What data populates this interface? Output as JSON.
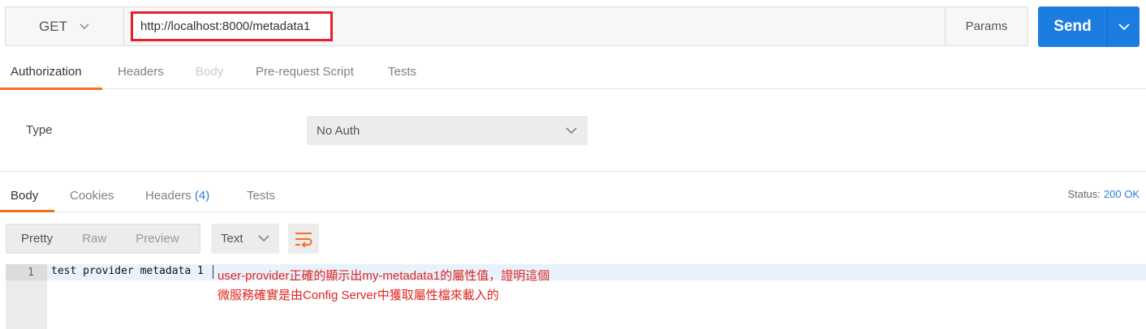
{
  "request": {
    "method": "GET",
    "url": "http://localhost:8000/metadata1",
    "params_label": "Params",
    "send_label": "Send"
  },
  "request_tabs": [
    {
      "label": "Authorization",
      "state": "active"
    },
    {
      "label": "Headers",
      "state": "normal"
    },
    {
      "label": "Body",
      "state": "disabled"
    },
    {
      "label": "Pre-request Script",
      "state": "normal"
    },
    {
      "label": "Tests",
      "state": "normal"
    }
  ],
  "auth": {
    "type_label": "Type",
    "selected": "No Auth"
  },
  "response_tabs": {
    "body": "Body",
    "cookies": "Cookies",
    "headers": "Headers",
    "headers_count": "(4)",
    "tests": "Tests"
  },
  "status": {
    "label": "Status:",
    "value": "200 OK"
  },
  "view": {
    "modes": [
      "Pretty",
      "Raw",
      "Preview"
    ],
    "active_mode": "Pretty",
    "format": "Text"
  },
  "response_body": {
    "line_number": "1",
    "content": "test provider metadata 1"
  },
  "annotation": {
    "line1": "user-provider正確的顯示出my-metadata1的屬性值，證明這個",
    "line2": "微服務確實是由Config Server中獲取屬性檔來載入的"
  },
  "colors": {
    "accent": "#f47023",
    "send_button": "#1c7ce0",
    "link_blue": "#2a7fd6",
    "highlight_box": "#e3202a",
    "annotation_text": "#e0231d"
  },
  "icons": [
    "chevron-down-icon",
    "wrap-lines-icon"
  ]
}
